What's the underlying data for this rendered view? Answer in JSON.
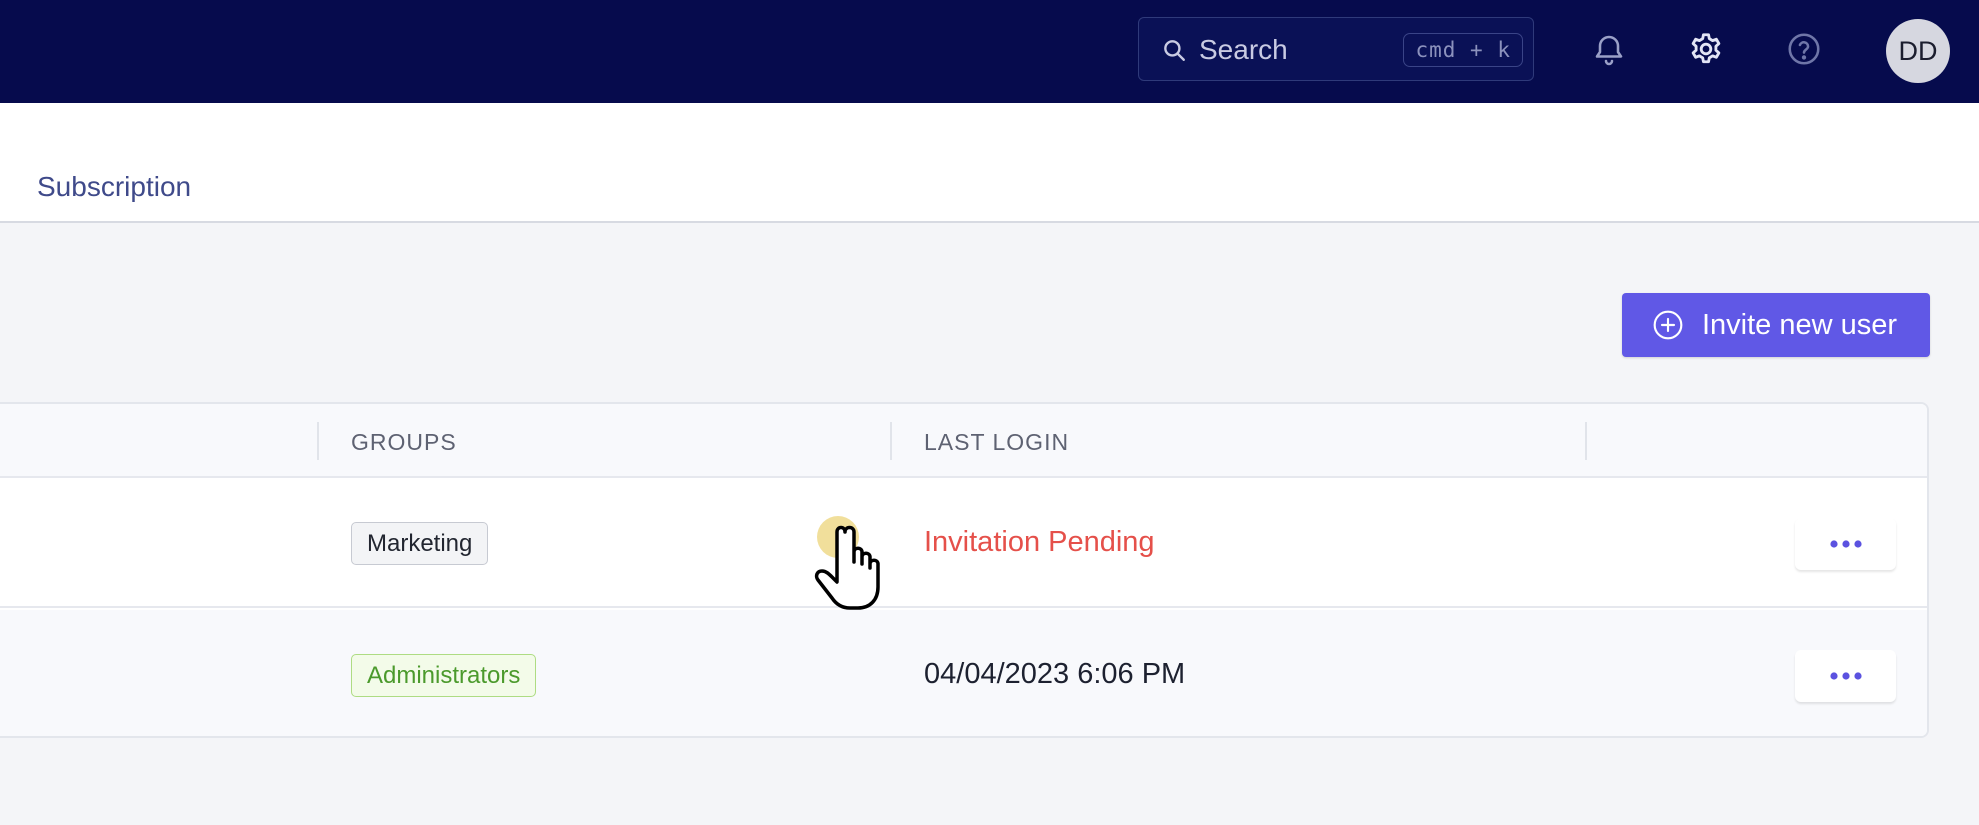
{
  "header": {
    "search": {
      "placeholder": "Search",
      "shortcut": "cmd + k"
    },
    "icons": [
      "bell-icon",
      "gear-icon",
      "help-icon"
    ],
    "avatar_initials": "DD",
    "background": "#060b4d"
  },
  "tabs": {
    "subscription": "Subscription"
  },
  "actions": {
    "invite_label": "Invite new user",
    "accent": "#6058e6"
  },
  "table": {
    "columns": {
      "groups": "GROUPS",
      "last_login": "LAST LOGIN"
    },
    "rows": [
      {
        "group": "Marketing",
        "last_login": "Invitation Pending",
        "status_color": "#e5504a"
      },
      {
        "group": "Administrators",
        "last_login": "04/04/2023 6:06 PM"
      }
    ]
  }
}
